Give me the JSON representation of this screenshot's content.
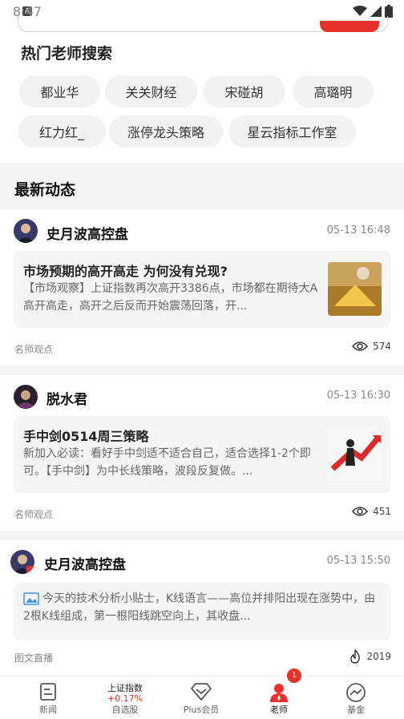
{
  "status_bar": {
    "time": "8:47",
    "a_glyph": "A"
  },
  "hot": {
    "title": "热门老师搜索",
    "chips": [
      "都业华",
      "关关财经",
      "宋碰胡",
      "高璐明",
      "红力红_",
      "涨停龙头策略",
      "星云指标工作室"
    ]
  },
  "feed": {
    "title": "最新动态",
    "items": [
      {
        "author": "史月波高控盘",
        "time": "05-13 16:48",
        "article_title": "市场预期的高开高走 为何没有兑现?",
        "summary": "【市场观察】上证指数再次高开3386点，市场都在期待大A高开高走，高开之后反而开始震荡回落，开...",
        "tag": "名师观点",
        "count": "574"
      },
      {
        "author": "脱水君",
        "time": "05-13 16:30",
        "article_title": "手中剑0514周三策略",
        "summary": "新加入必读：看好手中剑适不适合自己，适合选择1-2个即可。【手中剑】为中长线策略，波段反复做。...",
        "tag": "名师观点",
        "count": "451"
      },
      {
        "author": "史月波高控盘",
        "time": "05-13 15:50",
        "summary": "今天的技术分析小贴士，K线语言——高位并排阳出现在涨势中，由2根K线组成，第一根阳线跳空向上，其收盘...",
        "tag": "图文直播",
        "count": "2019"
      }
    ]
  },
  "tabbar": {
    "tabs": [
      {
        "label": "新闻",
        "icon": "news-icon"
      },
      {
        "label": "自选股",
        "icon": "watchlist"
      },
      {
        "label": "Plus会员",
        "icon": "plus-icon"
      },
      {
        "label": "老师",
        "icon": "teacher-icon"
      },
      {
        "label": "基金",
        "icon": "fund-icon"
      }
    ],
    "index_name": "上证指数",
    "index_change": "+0.17%",
    "teacher_badge": "1"
  },
  "colors": {
    "accent": "#e8312b",
    "chip_bg": "#f2f2f2",
    "card_bg": "#f5f5f5"
  }
}
